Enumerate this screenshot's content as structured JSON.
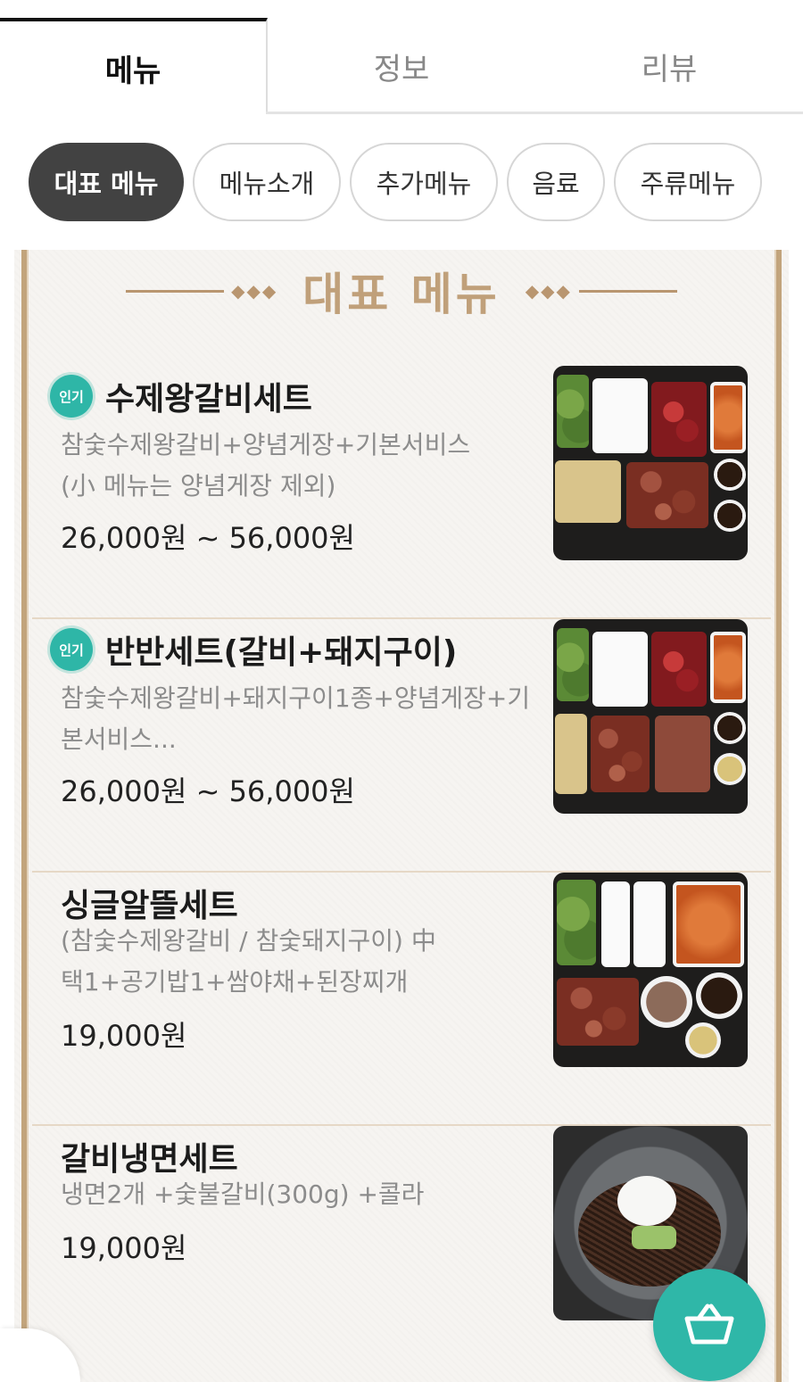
{
  "tabs": [
    {
      "label": "메뉴",
      "active": true
    },
    {
      "label": "정보",
      "active": false
    },
    {
      "label": "리뷰",
      "active": false
    }
  ],
  "categories": [
    {
      "label": "대표 메뉴",
      "active": true
    },
    {
      "label": "메뉴소개",
      "active": false
    },
    {
      "label": "추가메뉴",
      "active": false
    },
    {
      "label": "음료",
      "active": false
    },
    {
      "label": "주류메뉴",
      "active": false
    }
  ],
  "section": {
    "title": "대표 메뉴",
    "ornament": "◆◆◆"
  },
  "items": [
    {
      "badge": "인기",
      "name": "수제왕갈비세트",
      "desc_line1": "참숯수제왕갈비+양념게장+기본서비스",
      "desc_line2": "(小 메뉴는 양념게장 제외)",
      "price": "26,000원 ~ 56,000원"
    },
    {
      "badge": "인기",
      "name": "반반세트(갈비+돼지구이)",
      "desc_line1": "참숯수제왕갈비+돼지구이1종+양념게장+기",
      "desc_line2": "본서비스...",
      "price": "26,000원 ~ 56,000원"
    },
    {
      "badge": "",
      "name": "싱글알뜰세트",
      "desc_line1": "(참숯수제왕갈비 / 참숯돼지구이) 中",
      "desc_line2": "택1+공기밥1+쌈야채+된장찌개",
      "price": "19,000원"
    },
    {
      "badge": "",
      "name": "갈비냉면세트",
      "desc_line1": "냉면2개 +숯불갈비(300g) +콜라",
      "desc_line2": "",
      "price": "19,000원"
    }
  ],
  "cart": {
    "icon": "basket-icon"
  },
  "colors": {
    "accent": "#2fb7a8",
    "gold": "#c0a07a",
    "chip_active": "#424242"
  }
}
